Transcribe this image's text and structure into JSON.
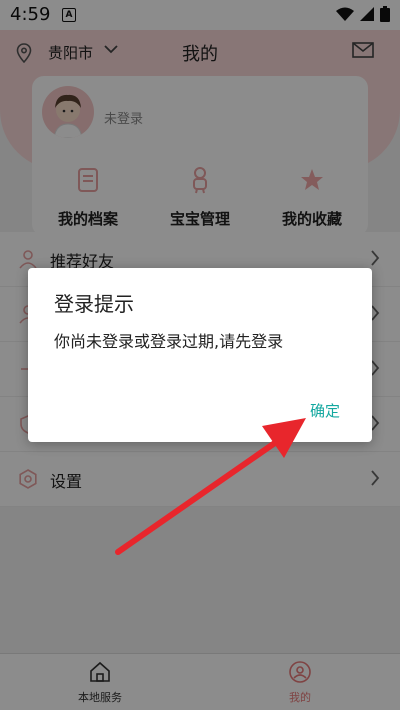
{
  "status": {
    "time": "4:59",
    "notif_icon": "A"
  },
  "header": {
    "city": "贵阳市",
    "title": "我的"
  },
  "profile": {
    "login_text": "未登录"
  },
  "quick_actions": [
    {
      "label": "我的档案",
      "icon": "document-icon"
    },
    {
      "label": "宝宝管理",
      "icon": "baby-icon"
    },
    {
      "label": "我的收藏",
      "icon": "star-icon"
    }
  ],
  "menu": [
    {
      "label": "推荐好友",
      "icon": "user-icon"
    },
    {
      "label": "",
      "icon": "user-icon"
    },
    {
      "label": "",
      "icon": "item-icon"
    },
    {
      "label": "",
      "icon": "shield-icon"
    },
    {
      "label": "设置",
      "icon": "gear-icon"
    }
  ],
  "bottom_nav": [
    {
      "label": "本地服务",
      "icon": "home-icon"
    },
    {
      "label": "我的",
      "icon": "person-circle-icon"
    }
  ],
  "dialog": {
    "title": "登录提示",
    "message": "你尚未登录或登录过期,请先登录",
    "confirm": "确定"
  },
  "colors": {
    "accent": "#13a8a0",
    "pink": "#f7d8d8",
    "arrow": "#e8262c"
  }
}
